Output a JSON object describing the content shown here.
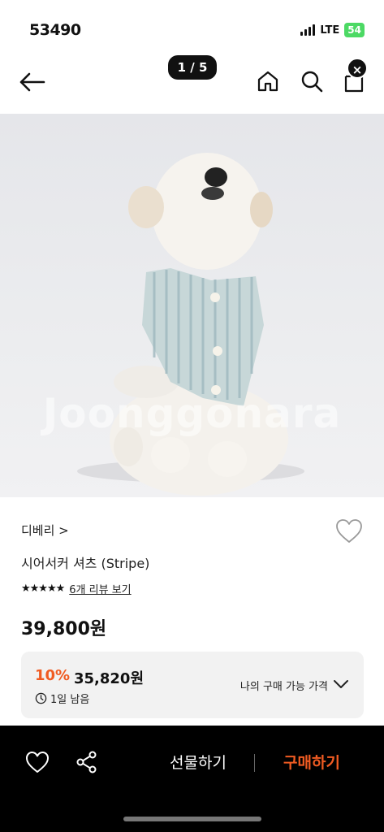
{
  "status_bar": {
    "time": "53490",
    "network": "LTE",
    "battery": "54"
  },
  "nav": {
    "image_counter": "1 / 5",
    "close_glyph": "×"
  },
  "hero": {
    "watermark": "Joonggonara",
    "alt": "dog wearing seersucker stripe shirt"
  },
  "product": {
    "brand": "디베리 >",
    "title": "시어서커 셔츠 (Stripe)",
    "stars": "★★★★★",
    "review_link": "6개 리뷰 보기",
    "price": "39,800원"
  },
  "coupon": {
    "discount": "10%",
    "price": "35,820원",
    "time_left": "1일 남음",
    "my_price_label": "나의 구매 가능 가격"
  },
  "bottom_bar": {
    "gift_label": "선물하기",
    "buy_label": "구매하기"
  },
  "colors": {
    "accent": "#f05b22",
    "battery": "#4cd964",
    "bottom_bar": "#000000"
  }
}
